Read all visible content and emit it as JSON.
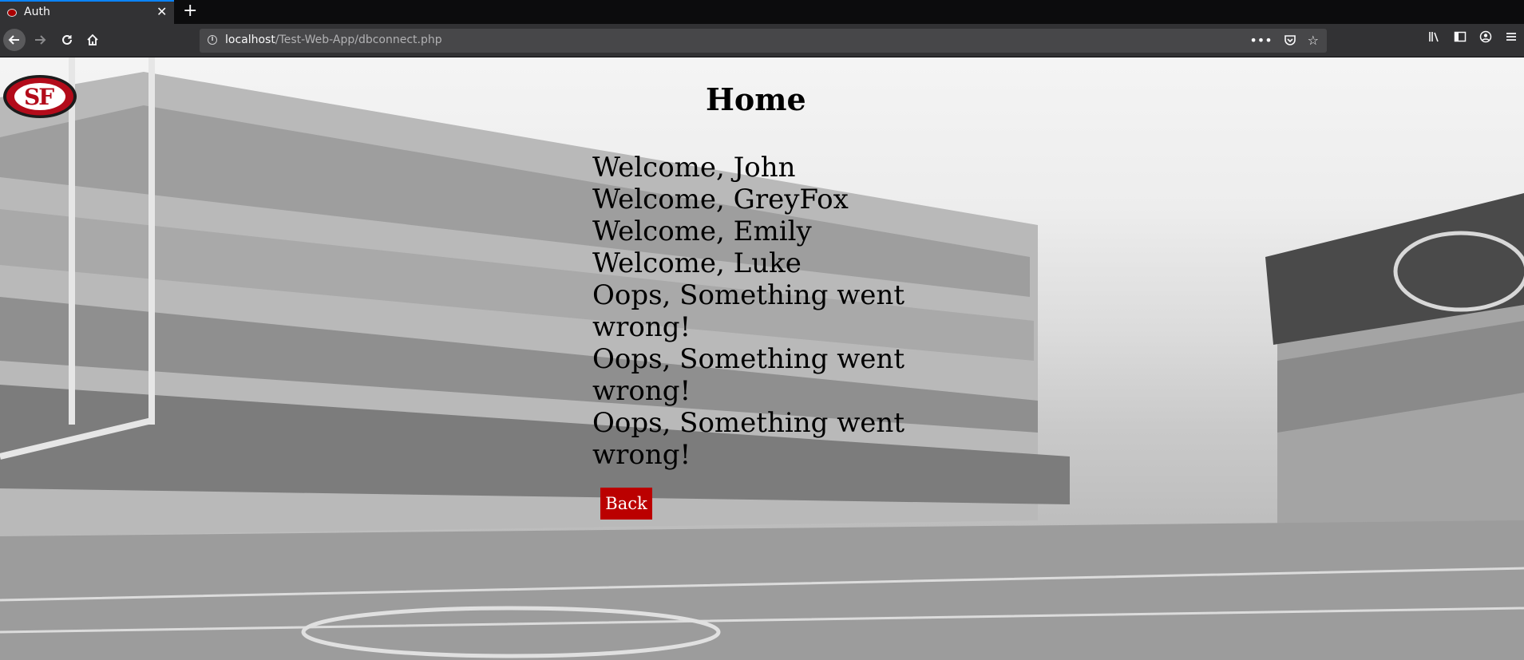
{
  "browser": {
    "tab": {
      "title": "Auth"
    },
    "url": {
      "host": "localhost",
      "path": "/Test-Web-App/dbconnect.php"
    }
  },
  "page": {
    "title": "Home",
    "messages": [
      "Welcome, John",
      "Welcome, GreyFox",
      "Welcome, Emily",
      "Welcome, Luke",
      "Oops, Something went wrong!",
      "Oops, Something went wrong!",
      "Oops, Something went wrong!"
    ],
    "back_button": "Back",
    "logo_text": "SF"
  },
  "colors": {
    "chrome_dark": "#0c0c0d",
    "chrome": "#323234",
    "url_field": "#474749",
    "button_red": "#bb0000",
    "logo_red": "#aa0000"
  },
  "icons": [
    "favicon",
    "close-icon",
    "plus-icon",
    "back-arrow-icon",
    "forward-arrow-icon",
    "reload-icon",
    "home-icon",
    "info-icon",
    "more-icon",
    "pocket-icon",
    "star-icon",
    "library-icon",
    "sidebar-icon",
    "account-icon",
    "menu-icon"
  ]
}
